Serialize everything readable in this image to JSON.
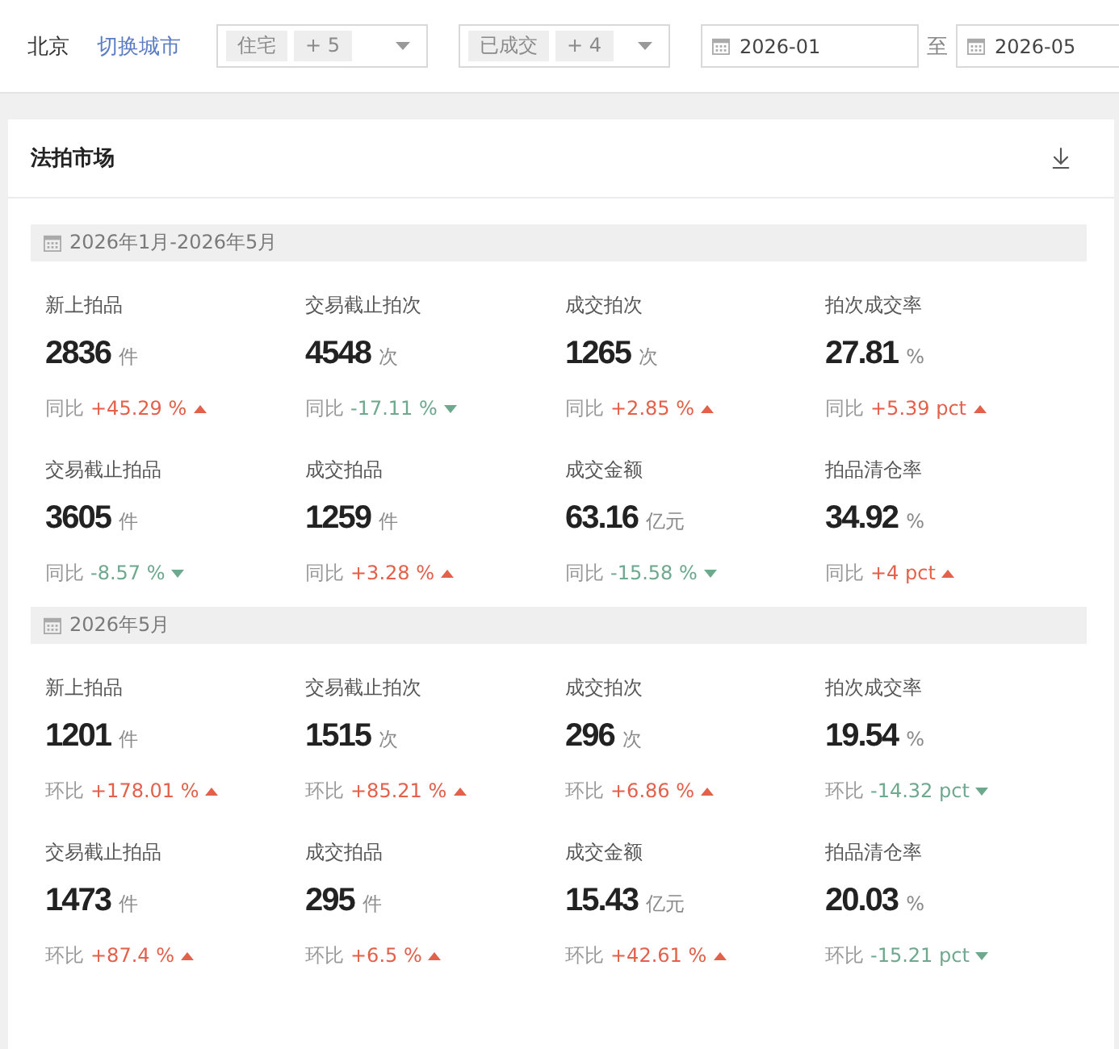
{
  "top_bar": {
    "city": "北京",
    "switch_city_link": "切换城市",
    "filters": [
      {
        "tags": [
          "住宅",
          "+ 5"
        ]
      },
      {
        "tags": [
          "已成交",
          "+ 4"
        ]
      }
    ],
    "date_range": {
      "start": "2026-01",
      "separator": "至",
      "end": "2026-05"
    }
  },
  "card": {
    "title": "法拍市场",
    "sections": [
      {
        "period": "2026年1月-2026年5月",
        "metrics": [
          {
            "label": "新上拍品",
            "value": "2836",
            "unit": "件",
            "compare_label": "同比",
            "change": "+45.29 %",
            "increase": true
          },
          {
            "label": "交易截止拍次",
            "value": "4548",
            "unit": "次",
            "compare_label": "同比",
            "change": "-17.11 %",
            "increase": false
          },
          {
            "label": "成交拍次",
            "value": "1265",
            "unit": "次",
            "compare_label": "同比",
            "change": "+2.85 %",
            "increase": true
          },
          {
            "label": "拍次成交率",
            "value": "27.81",
            "unit": "%",
            "compare_label": "同比",
            "change": "+5.39 pct",
            "increase": true
          },
          {
            "label": "交易截止拍品",
            "value": "3605",
            "unit": "件",
            "compare_label": "同比",
            "change": "-8.57 %",
            "increase": false
          },
          {
            "label": "成交拍品",
            "value": "1259",
            "unit": "件",
            "compare_label": "同比",
            "change": "+3.28 %",
            "increase": true
          },
          {
            "label": "成交金额",
            "value": "63.16",
            "unit": "亿元",
            "compare_label": "同比",
            "change": "-15.58 %",
            "increase": false
          },
          {
            "label": "拍品清仓率",
            "value": "34.92",
            "unit": "%",
            "compare_label": "同比",
            "change": "+4 pct",
            "increase": true
          }
        ]
      },
      {
        "period": "2026年5月",
        "metrics": [
          {
            "label": "新上拍品",
            "value": "1201",
            "unit": "件",
            "compare_label": "环比",
            "change": "+178.01 %",
            "increase": true
          },
          {
            "label": "交易截止拍次",
            "value": "1515",
            "unit": "次",
            "compare_label": "环比",
            "change": "+85.21 %",
            "increase": true
          },
          {
            "label": "成交拍次",
            "value": "296",
            "unit": "次",
            "compare_label": "环比",
            "change": "+6.86 %",
            "increase": true
          },
          {
            "label": "拍次成交率",
            "value": "19.54",
            "unit": "%",
            "compare_label": "环比",
            "change": "-14.32 pct",
            "increase": false
          },
          {
            "label": "交易截止拍品",
            "value": "1473",
            "unit": "件",
            "compare_label": "环比",
            "change": "+87.4 %",
            "increase": true
          },
          {
            "label": "成交拍品",
            "value": "295",
            "unit": "件",
            "compare_label": "环比",
            "change": "+6.5 %",
            "increase": true
          },
          {
            "label": "成交金额",
            "value": "15.43",
            "unit": "亿元",
            "compare_label": "环比",
            "change": "+42.61 %",
            "increase": true
          },
          {
            "label": "拍品清仓率",
            "value": "20.03",
            "unit": "%",
            "compare_label": "环比",
            "change": "-15.21 pct",
            "increase": false
          }
        ]
      }
    ]
  }
}
